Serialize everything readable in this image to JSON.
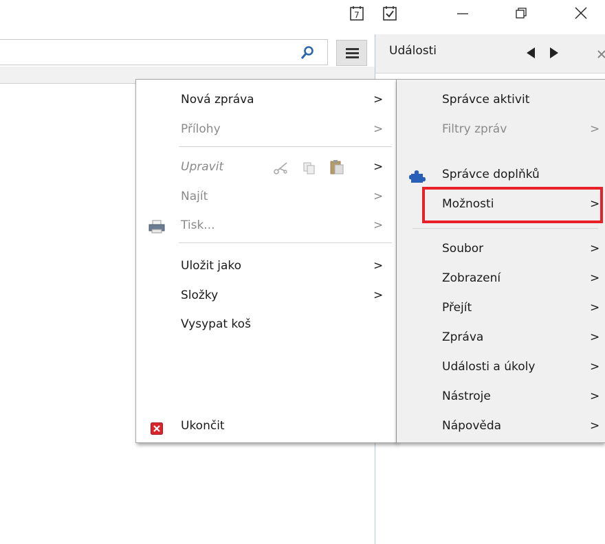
{
  "events_pane": {
    "title": "Události"
  },
  "search": {
    "value": "",
    "placeholder": ""
  },
  "app_menu": {
    "items": [
      {
        "id": "nova-zprava",
        "label": "Nová zpráva",
        "submenu": true,
        "enabled": true
      },
      {
        "id": "prilohy",
        "label": "Přílohy",
        "submenu": true,
        "enabled": false
      },
      {
        "id": "upravit",
        "label": "Upravit",
        "submenu": true,
        "enabled": false
      },
      {
        "id": "najit",
        "label": "Najít",
        "submenu": true,
        "enabled": false
      },
      {
        "id": "tisk",
        "label": "Tisk...",
        "submenu": true,
        "enabled": false
      },
      {
        "id": "ulozit-jako",
        "label": "Uložit jako",
        "submenu": true,
        "enabled": true
      },
      {
        "id": "slozky",
        "label": "Složky",
        "submenu": true,
        "enabled": true
      },
      {
        "id": "vysypat-kos",
        "label": "Vysypat koš",
        "submenu": false,
        "enabled": true
      },
      {
        "id": "ukoncit",
        "label": "Ukončit",
        "submenu": false,
        "enabled": true
      }
    ]
  },
  "side_menu": {
    "items": [
      {
        "id": "spravce-aktivit",
        "label": "Správce aktivit",
        "submenu": false,
        "enabled": true
      },
      {
        "id": "filtry-zprav",
        "label": "Filtry zpráv",
        "submenu": true,
        "enabled": false
      },
      {
        "id": "spravce-doplnku",
        "label": "Správce doplňků",
        "submenu": false,
        "enabled": true
      },
      {
        "id": "moznosti",
        "label": "Možnosti",
        "submenu": true,
        "enabled": true,
        "highlighted": true
      },
      {
        "id": "soubor",
        "label": "Soubor",
        "submenu": true,
        "enabled": true
      },
      {
        "id": "zobrazeni",
        "label": "Zobrazení",
        "submenu": true,
        "enabled": true
      },
      {
        "id": "prejit",
        "label": "Přejít",
        "submenu": true,
        "enabled": true
      },
      {
        "id": "zprava",
        "label": "Zpráva",
        "submenu": true,
        "enabled": true
      },
      {
        "id": "udalosti-a-ukoly",
        "label": "Události a úkoly",
        "submenu": true,
        "enabled": true
      },
      {
        "id": "nastroje",
        "label": "Nástroje",
        "submenu": true,
        "enabled": true
      },
      {
        "id": "napoveda",
        "label": "Nápověda",
        "submenu": true,
        "enabled": true
      }
    ]
  },
  "glyphs": {
    "arrow": ">",
    "calendar_day": "7"
  },
  "colors": {
    "highlight_border": "#e8202a",
    "search_icon": "#2a66b0",
    "addon_icon": "#2a5fb8",
    "quit_icon": "#d9262d"
  }
}
